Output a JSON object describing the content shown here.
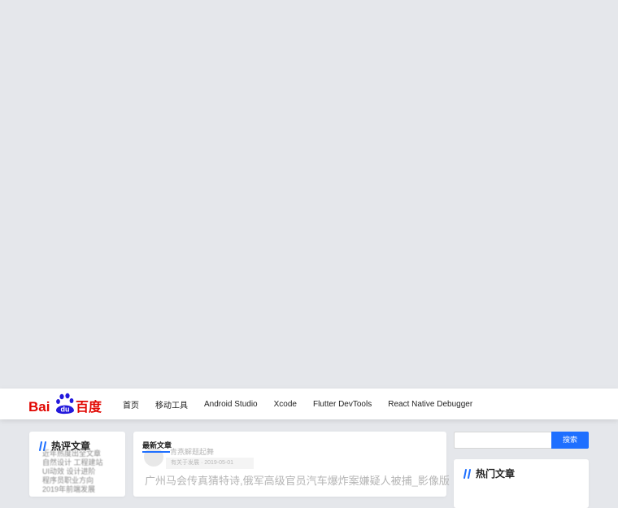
{
  "brand": {
    "logo_text_left": "Bai",
    "logo_paw_text": "du",
    "logo_text_right": "百度",
    "colors": {
      "red": "#e10601",
      "blue": "#2319dc"
    }
  },
  "nav": {
    "items": [
      {
        "label": "首页"
      },
      {
        "label": "移动工具"
      },
      {
        "label": "Android Studio"
      },
      {
        "label": "Xcode"
      },
      {
        "label": "Flutter DevTools"
      },
      {
        "label": "React Native Debugger"
      }
    ]
  },
  "left_widget": {
    "title": "热评文章",
    "icon": "slash-icon",
    "items": [
      "近年热度出全文章",
      "自然设计 工程建站",
      "UI动效 设计进阶",
      "程序员职业方向",
      "2019年前端发展"
    ]
  },
  "main": {
    "tab_label": "最新文章",
    "author_name": "青燕解题起舞",
    "meta_text": "有关于发展 · 2019-05-01",
    "article_title": "广州马会传真猜特诗,俄军高级官员汽车爆炸案嫌疑人被捕_影像版"
  },
  "search": {
    "placeholder": "",
    "button_label": "搜索"
  },
  "right_widget": {
    "title": "热门文章",
    "icon": "slash-icon"
  },
  "colors": {
    "accent": "#1e6fff",
    "background": "#e5e7eb"
  }
}
